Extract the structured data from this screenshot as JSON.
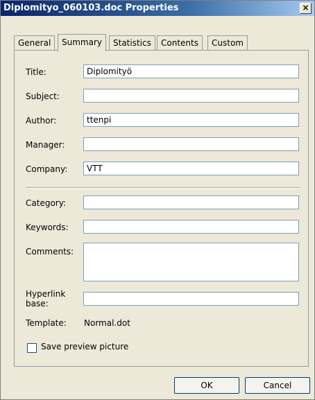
{
  "window": {
    "title": "Diplomityo_060103.doc Properties",
    "close_glyph": "×"
  },
  "tabs": [
    {
      "label": "General",
      "active": false
    },
    {
      "label": "Summary",
      "active": true
    },
    {
      "label": "Statistics",
      "active": false
    },
    {
      "label": "Contents",
      "active": false
    },
    {
      "label": "Custom",
      "active": false
    }
  ],
  "summary": {
    "title": {
      "label": "Title:",
      "value": "Diplomityö"
    },
    "subject": {
      "label": "Subject:",
      "value": ""
    },
    "author": {
      "label": "Author:",
      "value": "ttenpi"
    },
    "manager": {
      "label": "Manager:",
      "value": ""
    },
    "company": {
      "label": "Company:",
      "value": "VTT"
    },
    "category": {
      "label": "Category:",
      "value": ""
    },
    "keywords": {
      "label": "Keywords:",
      "value": ""
    },
    "comments": {
      "label": "Comments:",
      "value": ""
    },
    "hyperlink_base": {
      "label_line1": "Hyperlink",
      "label_line2": "base:",
      "value": ""
    },
    "template": {
      "label": "Template:",
      "value": "Normal.dot"
    },
    "save_preview": {
      "label": "Save preview picture",
      "checked": false
    }
  },
  "buttons": {
    "ok": "OK",
    "cancel": "Cancel"
  }
}
